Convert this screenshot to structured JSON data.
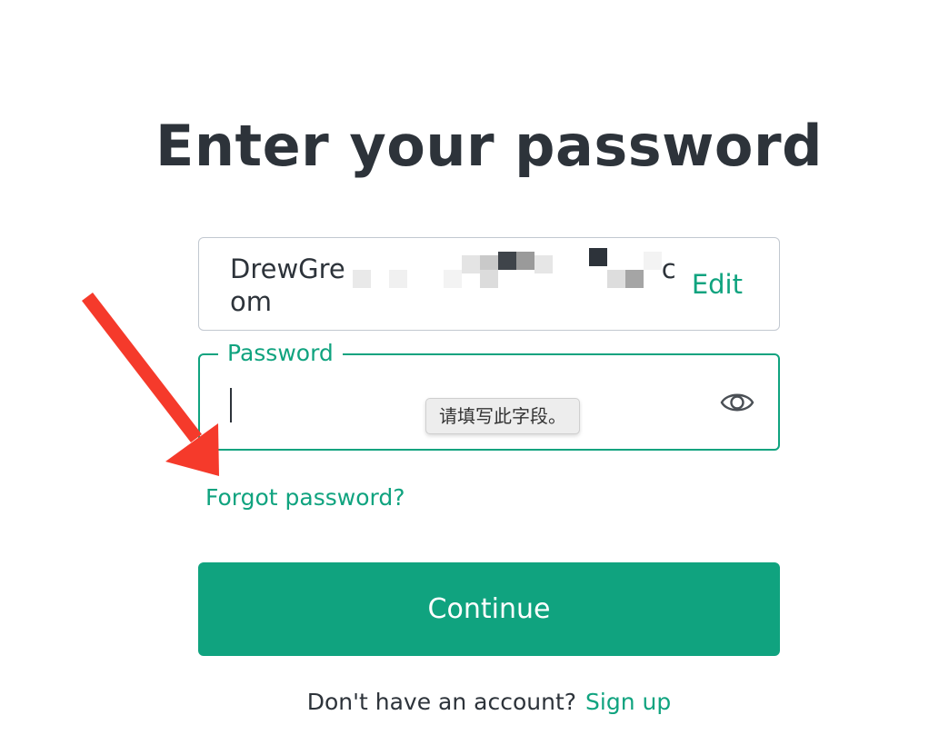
{
  "heading": "Enter your password",
  "email": {
    "line1": "DrewGre",
    "line1_end": "c",
    "line2": "om",
    "edit_label": "Edit"
  },
  "password": {
    "label": "Password",
    "value": "",
    "validation_tooltip": "请填写此字段。"
  },
  "forgot_link": "Forgot password?",
  "continue_label": "Continue",
  "signup": {
    "prompt": "Don't have an account?",
    "link": "Sign up"
  },
  "colors": {
    "accent": "#10a37f",
    "text": "#2d333a",
    "border": "#c2c8d0",
    "annotation_arrow": "#f53a2b"
  },
  "icons": {
    "password_toggle": "eye-icon",
    "annotation": "red-arrow-annotation"
  }
}
